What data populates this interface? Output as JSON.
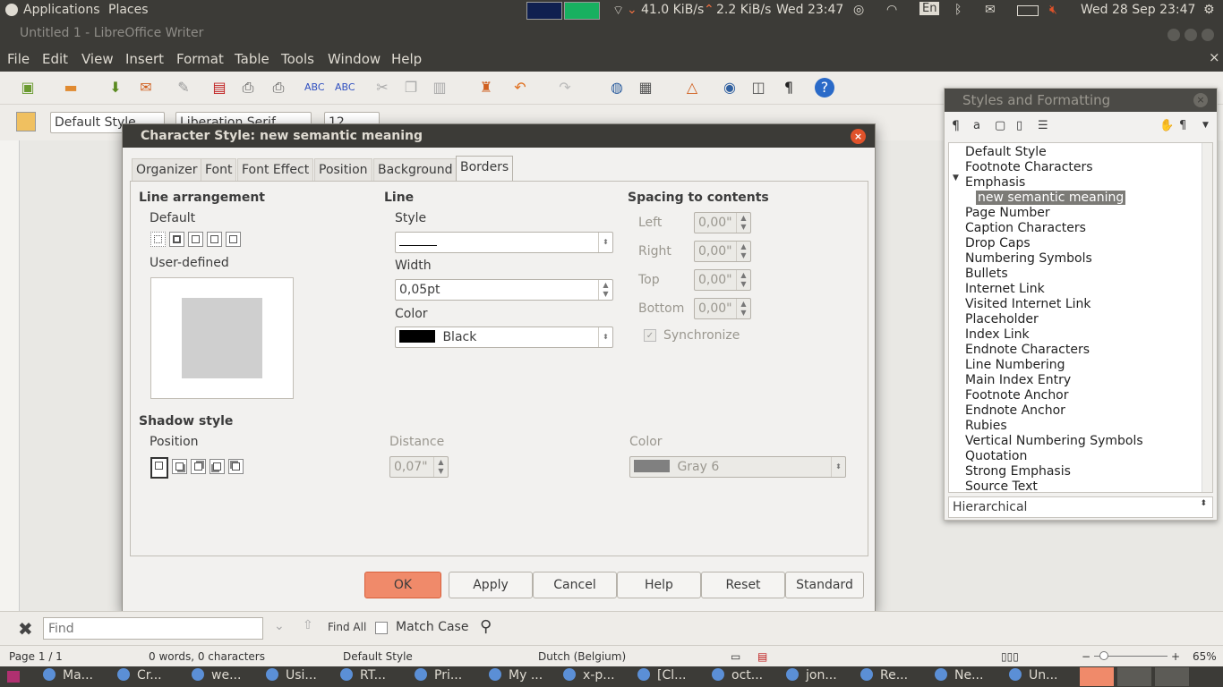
{
  "top_panel": {
    "applications": "Applications",
    "places": "Places",
    "net_down": "41.0 KiB/s",
    "net_up": "2.2 KiB/s",
    "clock_short": "Wed 23:47",
    "keyboard": "En",
    "clock_full": "Wed 28 Sep 23:47"
  },
  "window": {
    "title": "Untitled 1 - LibreOffice Writer"
  },
  "menu": [
    "File",
    "Edit",
    "View",
    "Insert",
    "Format",
    "Table",
    "Tools",
    "Window",
    "Help"
  ],
  "toolbar2": {
    "paragraph_style": "Default Style",
    "font_name": "Liberation Serif",
    "font_size": "12"
  },
  "dialog": {
    "title": "Character Style: new semantic meaning",
    "tabs": [
      "Organizer",
      "Font",
      "Font Effect",
      "Position",
      "Background",
      "Borders"
    ],
    "active_tab": "Borders",
    "line_arrangement": {
      "heading": "Line arrangement",
      "default_label": "Default",
      "user_defined_label": "User-defined"
    },
    "line": {
      "heading": "Line",
      "style_label": "Style",
      "width_label": "Width",
      "width_value": "0,05pt",
      "color_label": "Color",
      "color_value": "Black",
      "color_swatch": "#000000"
    },
    "spacing": {
      "heading": "Spacing to contents",
      "left_label": "Left",
      "left_value": "0,00\"",
      "right_label": "Right",
      "right_value": "0,00\"",
      "top_label": "Top",
      "top_value": "0,00\"",
      "bottom_label": "Bottom",
      "bottom_value": "0,00\"",
      "synchronize_label": "Synchronize"
    },
    "shadow": {
      "heading": "Shadow style",
      "position_label": "Position",
      "distance_label": "Distance",
      "distance_value": "0,07\"",
      "color_label": "Color",
      "color_value": "Gray 6",
      "color_swatch": "#808080"
    },
    "buttons": {
      "ok": "OK",
      "apply": "Apply",
      "cancel": "Cancel",
      "help": "Help",
      "reset": "Reset",
      "standard": "Standard"
    }
  },
  "styles_panel": {
    "title": "Styles and Formatting",
    "items": [
      "Default Style",
      "Footnote Characters",
      "Emphasis",
      "new semantic meaning",
      "Page Number",
      "Caption Characters",
      "Drop Caps",
      "Numbering Symbols",
      "Bullets",
      "Internet Link",
      "Visited Internet Link",
      "Placeholder",
      "Index Link",
      "Endnote Characters",
      "Line Numbering",
      "Main Index Entry",
      "Footnote Anchor",
      "Endnote Anchor",
      "Rubies",
      "Vertical Numbering Symbols",
      "Quotation",
      "Strong Emphasis",
      "Source Text"
    ],
    "selected_index": 3,
    "filter": "Hierarchical"
  },
  "findbar": {
    "placeholder": "Find",
    "find_all": "Find All",
    "match_case": "Match Case"
  },
  "statusbar": {
    "page": "Page 1 / 1",
    "words": "0 words, 0 characters",
    "style": "Default Style",
    "language": "Dutch (Belgium)",
    "zoom": "65%"
  },
  "taskbar": [
    "Ma...",
    "Cr...",
    "we...",
    "Usi...",
    "RT...",
    "Pri...",
    "My ...",
    "x-p...",
    "[Cl...",
    "oct...",
    "jon...",
    "Re...",
    "Ne...",
    "Un..."
  ],
  "colors": {
    "accent": "#f08a6a",
    "panel": "#3c3b37"
  }
}
